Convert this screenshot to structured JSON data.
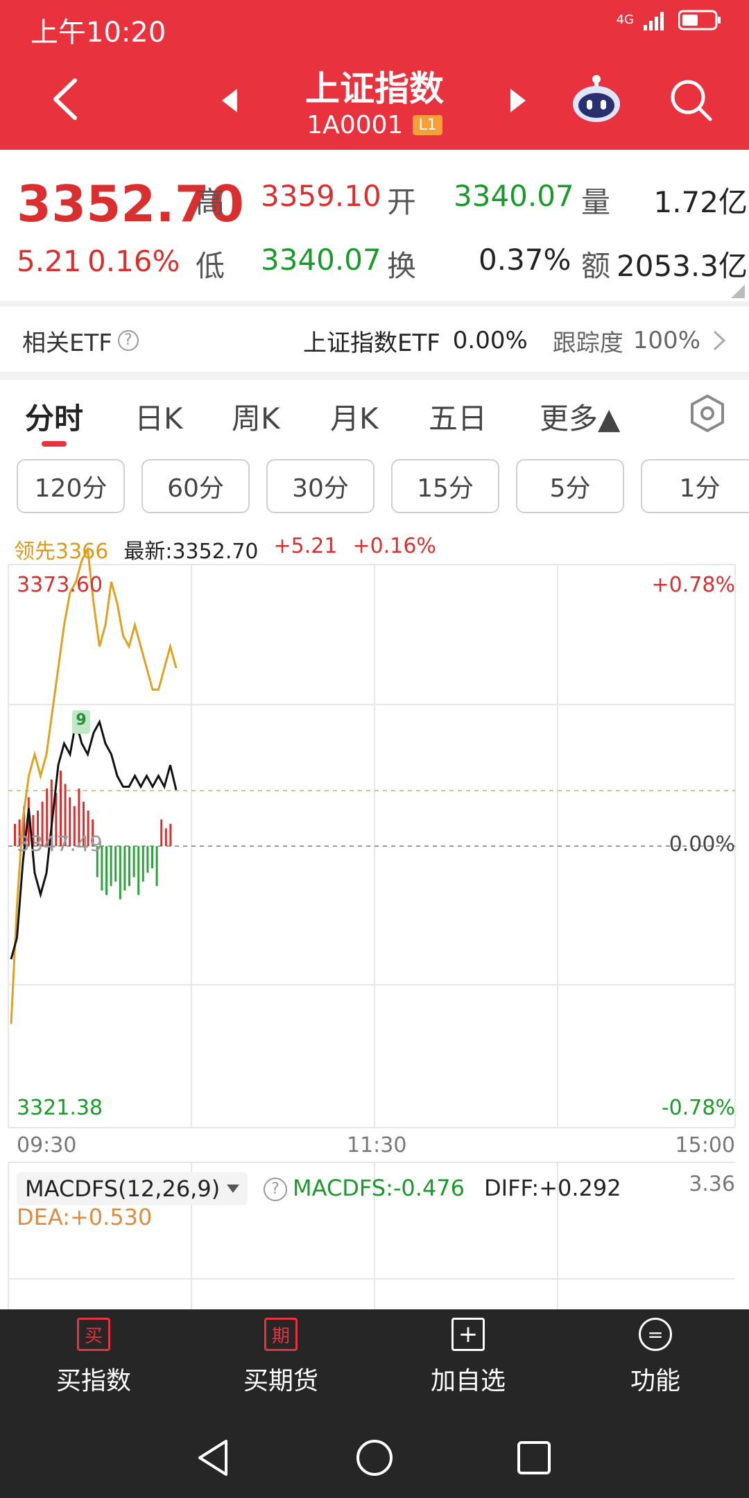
{
  "status_bar": {
    "time": "上午10:20",
    "network": "4G"
  },
  "header": {
    "title": "上证指数",
    "code": "1A0001",
    "level": "L1"
  },
  "quote": {
    "price": "3352.70",
    "change": "5.21",
    "change_pct": "0.16%",
    "high_label": "高",
    "high_value": "3359.10",
    "open_label": "开",
    "open_value": "3340.07",
    "volume_label": "量",
    "volume_value": "1.72亿",
    "low_label": "低",
    "low_value": "3340.07",
    "turnover_label": "换",
    "turnover_value": "0.37%",
    "amount_label": "额",
    "amount_value": "2053.3亿"
  },
  "etf": {
    "label": "相关ETF",
    "help": "?",
    "name": "上证指数ETF",
    "value": "0.00%",
    "tracking_label": "跟踪度",
    "tracking_value": "100%"
  },
  "tabs": [
    "分时",
    "日K",
    "周K",
    "月K",
    "五日",
    "更多▲"
  ],
  "segments": [
    "120分",
    "60分",
    "30分",
    "15分",
    "5分",
    "1分"
  ],
  "chart_header": {
    "lead": "领先3366",
    "latest": "最新:3352.70",
    "change": "+5.21",
    "change_pct": "+0.16%"
  },
  "chart_labels": {
    "top_price": "3373.60",
    "top_pct": "+0.78%",
    "mid_price": "3347.49",
    "mid_pct": "0.00%",
    "bottom_price": "3321.38",
    "bottom_pct": "-0.78%",
    "marker": "9",
    "time_start": "09:30",
    "time_mid": "11:30",
    "time_end": "15:00"
  },
  "macd": {
    "selector": "MACDFS(12,26,9)",
    "help": "?",
    "macdfs": "MACDFS:-0.476",
    "diff": "DIFF:+0.292",
    "dea": "DEA:+0.530",
    "scale_max": "3.36"
  },
  "chart_data": {
    "type": "line",
    "xlabel": "",
    "ylabel": "",
    "ylim": [
      3321.38,
      3373.6
    ],
    "x_ticks": [
      "09:30",
      "11:30",
      "15:00"
    ],
    "series": [
      {
        "name": "",
        "color": "#111111",
        "values": [
          3337,
          3339,
          3346,
          3351,
          3345,
          3343,
          3345,
          3350,
          3355,
          3357,
          3356,
          3359,
          3357,
          3356,
          3358,
          3359,
          3357,
          3356,
          3354,
          3353,
          3353,
          3354,
          3353,
          3354,
          3353,
          3354,
          3353,
          3355,
          3352.7
        ]
      },
      {
        "name": "",
        "color": "#e0a020",
        "values": [
          3331,
          3342,
          3350,
          3354,
          3356,
          3354,
          3356,
          3360,
          3364,
          3368,
          3371,
          3372,
          3374,
          3375,
          3370,
          3366,
          3368,
          3372,
          3370,
          3367,
          3366,
          3368,
          3366,
          3364,
          3362,
          3362,
          3364,
          3366,
          3364
        ]
      }
    ],
    "volume_bars": [
      10,
      12,
      18,
      22,
      14,
      16,
      20,
      26,
      30,
      24,
      34,
      28,
      22,
      18,
      26,
      20,
      16,
      12,
      -14,
      -20,
      -22,
      -18,
      -16,
      -24,
      -20,
      -18,
      -14,
      -22,
      -16,
      -12,
      -10,
      -18,
      12,
      8,
      10
    ]
  },
  "trade_bar": [
    {
      "icon": "买",
      "label": "买指数"
    },
    {
      "icon": "期",
      "label": "买期货"
    },
    {
      "icon": "+",
      "label": "加自选"
    },
    {
      "icon": "=",
      "label": "功能"
    }
  ]
}
